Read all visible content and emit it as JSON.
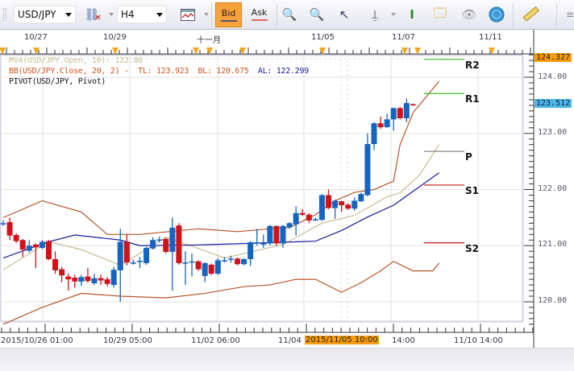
{
  "toolbar": {
    "symbol": "USD/JPY",
    "timeframe": "H4",
    "bid_label": "Bid",
    "ask_label": "Ask",
    "icons": [
      "link-remove-icon",
      "chart-type-icon",
      "zoom-in-icon",
      "zoom-out-icon",
      "zoom-cursor-icon",
      "zoom-range-icon",
      "scale-fit-icon",
      "properties-icon",
      "hide-icon",
      "globe-icon",
      "ruler-icon",
      "menu-icon"
    ]
  },
  "top_axis": {
    "labels": [
      "10/27",
      "10/29",
      "十一月",
      "11/05",
      "11/07",
      "11/11"
    ]
  },
  "indicators": {
    "mva": "MVA(USD/JPY.Open, 10): 122.80",
    "bb": "BB(USD/JPY.Close, 20, 2) -  TL: 123.923  BL: 120.675",
    "bb_al": "AL: 122.299",
    "pivot": "PIVOT(USD/JPY, Pivot)"
  },
  "colors": {
    "bull": "#1565c0",
    "bear": "#d0121b",
    "bb_band": "#b5542a",
    "bb_avg": "#1a1a9a",
    "mva": "#c8bd95",
    "accent": "#f99b0c",
    "current": "#4db7ea"
  },
  "chart_data": {
    "type": "candlestick",
    "symbol": "USD/JPY",
    "timeframe": "H4",
    "ylim": [
      119.6,
      124.4
    ],
    "y_ticks": [
      "124.00",
      "123.00",
      "122.00",
      "121.00",
      "120.00"
    ],
    "x_labels": [
      "2015/10/26 01:00",
      "10/29 05:00",
      "11/02 06:00",
      "11/04",
      "14:00",
      "11/10 14:00"
    ],
    "crosshair_time": "2015/11/05 10:00",
    "price_markers": {
      "high": "124.327",
      "current": "123.512"
    },
    "pivots": [
      {
        "name": "R2",
        "value": 124.32,
        "color": "#3bbf2a"
      },
      {
        "name": "R1",
        "value": 123.71,
        "color": "#3bbf2a"
      },
      {
        "name": "P",
        "value": 122.68,
        "color": "#777777"
      },
      {
        "name": "S1",
        "value": 122.08,
        "color": "#c01010"
      },
      {
        "name": "S2",
        "value": 121.05,
        "color": "#c01010"
      }
    ],
    "ohlc": [
      [
        121.4,
        121.45,
        121.35,
        121.4
      ],
      [
        121.42,
        121.5,
        121.1,
        121.18
      ],
      [
        121.19,
        121.22,
        121.05,
        121.08
      ],
      [
        121.1,
        121.12,
        120.8,
        120.93
      ],
      [
        120.91,
        121.1,
        120.88,
        121.0
      ],
      [
        121.02,
        121.04,
        120.6,
        120.97
      ],
      [
        120.96,
        121.1,
        120.94,
        121.07
      ],
      [
        121.08,
        121.1,
        120.74,
        120.76
      ],
      [
        120.76,
        120.9,
        120.5,
        120.56
      ],
      [
        120.58,
        120.62,
        120.35,
        120.47
      ],
      [
        120.45,
        120.5,
        120.2,
        120.4
      ],
      [
        120.43,
        120.48,
        120.25,
        120.36
      ],
      [
        120.36,
        120.48,
        120.28,
        120.44
      ],
      [
        120.45,
        120.6,
        120.34,
        120.37
      ],
      [
        120.33,
        120.5,
        120.3,
        120.42
      ],
      [
        120.42,
        120.48,
        120.3,
        120.38
      ],
      [
        120.4,
        120.44,
        120.28,
        120.32
      ],
      [
        120.3,
        120.62,
        120.25,
        120.57
      ],
      [
        120.56,
        121.3,
        120.0,
        121.07
      ],
      [
        121.07,
        121.2,
        120.65,
        120.7
      ],
      [
        120.7,
        120.75,
        120.66,
        120.7
      ],
      [
        120.73,
        120.8,
        120.6,
        120.73
      ],
      [
        120.69,
        120.98,
        120.66,
        120.96
      ],
      [
        120.95,
        121.15,
        120.93,
        121.1
      ],
      [
        121.1,
        121.16,
        121.06,
        121.11
      ],
      [
        121.12,
        121.14,
        120.86,
        120.89
      ],
      [
        120.89,
        121.5,
        120.2,
        121.32
      ],
      [
        121.36,
        121.4,
        120.66,
        120.69
      ],
      [
        120.7,
        120.9,
        120.3,
        120.7
      ],
      [
        120.72,
        120.86,
        120.45,
        120.72
      ],
      [
        120.72,
        120.74,
        120.55,
        120.58
      ],
      [
        120.46,
        120.7,
        120.35,
        120.69
      ],
      [
        120.66,
        120.68,
        120.48,
        120.5
      ],
      [
        120.5,
        120.78,
        120.48,
        120.74
      ],
      [
        120.74,
        120.8,
        120.7,
        120.74
      ],
      [
        120.76,
        120.82,
        120.7,
        120.77
      ],
      [
        120.77,
        120.79,
        120.65,
        120.67
      ],
      [
        120.67,
        120.78,
        120.65,
        120.76
      ],
      [
        120.76,
        121.08,
        120.64,
        121.06
      ],
      [
        121.06,
        121.3,
        121.0,
        121.06
      ],
      [
        121.04,
        121.2,
        120.96,
        121.04
      ],
      [
        121.04,
        121.37,
        121.0,
        121.35
      ],
      [
        121.35,
        121.36,
        121.0,
        121.04
      ],
      [
        121.04,
        121.37,
        120.96,
        121.35
      ],
      [
        121.33,
        121.42,
        121.3,
        121.4
      ],
      [
        121.38,
        121.7,
        121.18,
        121.58
      ],
      [
        121.58,
        121.65,
        121.53,
        121.55
      ],
      [
        121.55,
        121.58,
        121.4,
        121.45
      ],
      [
        121.46,
        121.5,
        121.44,
        121.47
      ],
      [
        121.46,
        121.92,
        121.44,
        121.9
      ],
      [
        121.9,
        122.0,
        121.65,
        121.67
      ],
      [
        121.67,
        121.82,
        121.48,
        121.8
      ],
      [
        121.79,
        121.8,
        121.6,
        121.72
      ],
      [
        121.73,
        121.75,
        121.64,
        121.66
      ],
      [
        121.66,
        121.86,
        121.62,
        121.8
      ],
      [
        121.79,
        121.94,
        121.78,
        121.92
      ],
      [
        121.9,
        123.0,
        121.88,
        122.81
      ],
      [
        122.81,
        123.2,
        122.7,
        123.18
      ],
      [
        123.18,
        123.3,
        123.08,
        123.11
      ],
      [
        123.11,
        123.35,
        123.1,
        123.25
      ],
      [
        123.25,
        123.46,
        123.05,
        123.45
      ],
      [
        123.45,
        123.47,
        123.25,
        123.27
      ],
      [
        123.27,
        123.62,
        123.2,
        123.54
      ],
      [
        123.52,
        123.53,
        123.49,
        123.5
      ]
    ],
    "bb_upper": [
      [
        0,
        121.5
      ],
      [
        6,
        121.8
      ],
      [
        12,
        121.6
      ],
      [
        16,
        121.2
      ],
      [
        21,
        121.2
      ],
      [
        30,
        121.3
      ],
      [
        36,
        121.25
      ],
      [
        41,
        121.3
      ],
      [
        44,
        121.32
      ],
      [
        48,
        121.55
      ],
      [
        51,
        121.8
      ],
      [
        54,
        121.95
      ],
      [
        57,
        122.0
      ],
      [
        60,
        122.15
      ],
      [
        61,
        122.8
      ],
      [
        63,
        123.37
      ],
      [
        67,
        123.93
      ]
    ],
    "bb_avg": [
      [
        0,
        120.78
      ],
      [
        7,
        121.07
      ],
      [
        11,
        121.19
      ],
      [
        18,
        121.1
      ],
      [
        21,
        121.0
      ],
      [
        29,
        121.01
      ],
      [
        35,
        121.03
      ],
      [
        48,
        121.08
      ],
      [
        52,
        121.27
      ],
      [
        56,
        121.51
      ],
      [
        60,
        121.72
      ],
      [
        67,
        122.3
      ]
    ],
    "bb_lower": [
      [
        0,
        119.6
      ],
      [
        6,
        119.9
      ],
      [
        12,
        120.15
      ],
      [
        18,
        120.1
      ],
      [
        25,
        120.07
      ],
      [
        31,
        120.15
      ],
      [
        37,
        120.27
      ],
      [
        41,
        120.3
      ],
      [
        45,
        120.4
      ],
      [
        48,
        120.4
      ],
      [
        52,
        120.17
      ],
      [
        55,
        120.34
      ],
      [
        58,
        120.55
      ],
      [
        60,
        120.72
      ],
      [
        63,
        120.55
      ],
      [
        66,
        120.55
      ],
      [
        67,
        120.69
      ]
    ],
    "mva": [
      [
        0,
        120.57
      ],
      [
        7,
        121.07
      ],
      [
        12,
        120.93
      ],
      [
        18,
        120.65
      ],
      [
        25,
        121.15
      ],
      [
        30,
        120.95
      ],
      [
        34,
        120.78
      ],
      [
        43,
        121.02
      ],
      [
        49,
        121.4
      ],
      [
        54,
        121.54
      ],
      [
        59,
        121.87
      ],
      [
        61,
        121.94
      ],
      [
        64,
        122.26
      ],
      [
        67,
        122.8
      ]
    ]
  }
}
